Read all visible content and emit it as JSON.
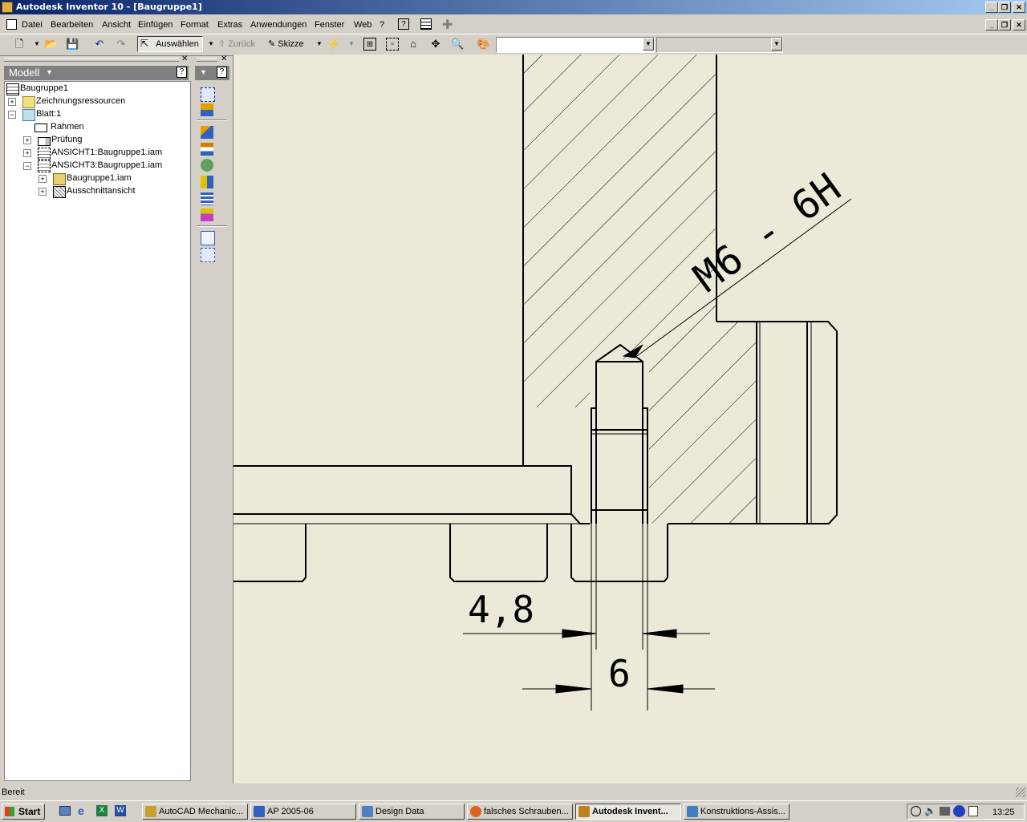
{
  "window": {
    "title": "Autodesk Inventor 10 - [Baugruppe1]",
    "app_icon": "inventor-icon",
    "caption_buttons": [
      "_",
      "❐",
      "✕"
    ]
  },
  "menu": {
    "items": [
      "Datei",
      "Bearbeiten",
      "Ansicht",
      "Einfügen",
      "Format",
      "Extras",
      "Anwendungen",
      "Fenster",
      "Web",
      "?"
    ]
  },
  "toolbar": {
    "select_label": "Auswählen",
    "back_label": "Zurück",
    "sketch_label": "Skizze",
    "style_combo_value": "",
    "layer_combo_value": ""
  },
  "browser": {
    "header": "Modell",
    "tree": [
      {
        "label": "Baugruppe1",
        "expander": "",
        "icon": "drawing-icon"
      },
      {
        "label": "Zeichnungsressourcen",
        "expander": "+",
        "icon": "folder-icon"
      },
      {
        "label": "Blatt:1",
        "expander": "−",
        "icon": "sheet-icon"
      },
      {
        "label": "Rahmen",
        "expander": "",
        "icon": "border-icon"
      },
      {
        "label": "Prüfung",
        "expander": "+",
        "icon": "titleblock-icon"
      },
      {
        "label": "ANSICHT1:Baugruppe1.iam",
        "expander": "+",
        "icon": "view-icon"
      },
      {
        "label": "ANSICHT3:Baugruppe1.iam",
        "expander": "−",
        "icon": "view-icon"
      },
      {
        "label": "Baugruppe1.iam",
        "expander": "+",
        "icon": "assembly-icon"
      },
      {
        "label": "Ausschnittansicht",
        "expander": "+",
        "icon": "detail-view-icon"
      }
    ]
  },
  "drawing": {
    "thread_note": "M6 - 6H",
    "dim_inner": "4,8",
    "dim_outer": "6"
  },
  "status": {
    "text": "Bereit"
  },
  "taskbar": {
    "start": "Start",
    "tasks": [
      {
        "label": "AutoCAD Mechanic...",
        "active": false,
        "color": "#c8a030"
      },
      {
        "label": "AP 2005-06",
        "active": false,
        "color": "#3060c0"
      },
      {
        "label": "Design Data",
        "active": false,
        "color": "#5080c0"
      },
      {
        "label": "falsches Schrauben...",
        "active": false,
        "color": "#e06020"
      },
      {
        "label": "Autodesk Invent...",
        "active": true,
        "color": "#c08020"
      },
      {
        "label": "Konstruktions-Assis...",
        "active": false,
        "color": "#4080c0"
      }
    ],
    "clock": "13:25"
  }
}
